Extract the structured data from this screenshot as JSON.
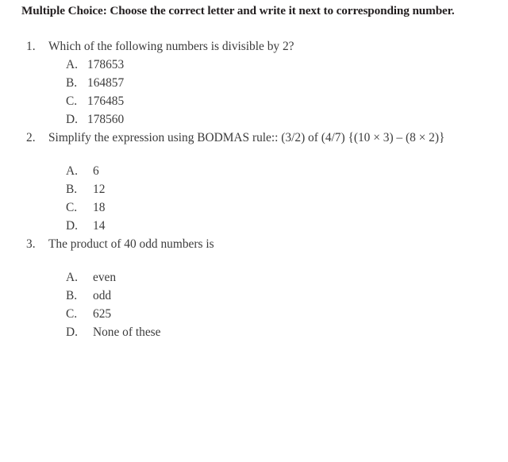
{
  "document": {
    "heading": "Multiple Choice: Choose the correct letter and write it next to corresponding number.",
    "background_color": "#ffffff",
    "text_color": "#3b3b3b",
    "heading_color": "#231f20",
    "questions": [
      {
        "number": "1.",
        "text": "Which of the following numbers is divisible by 2?",
        "has_blank_line_before_options": false,
        "options": [
          {
            "letter": "A.",
            "text": "178653"
          },
          {
            "letter": "B.",
            "text": "164857"
          },
          {
            "letter": "C.",
            "text": "176485"
          },
          {
            "letter": "D.",
            "text": "178560"
          }
        ]
      },
      {
        "number": "2.",
        "text": "Simplify the expression using BODMAS rule:: (3/2) of (4/7) {(10 × 3) – (8 × 2)}",
        "has_blank_line_before_options": true,
        "options": [
          {
            "letter": "A.",
            "text": "6"
          },
          {
            "letter": "B.",
            "text": "12"
          },
          {
            "letter": "C.",
            "text": "18"
          },
          {
            "letter": "D.",
            "text": "14"
          }
        ]
      },
      {
        "number": "3.",
        "text": "The product of 40 odd numbers is",
        "has_blank_line_before_options": true,
        "options": [
          {
            "letter": "A.",
            "text": "even"
          },
          {
            "letter": "B.",
            "text": "odd"
          },
          {
            "letter": "C.",
            "text": "625"
          },
          {
            "letter": "D.",
            "text": "None of these"
          }
        ]
      }
    ]
  }
}
